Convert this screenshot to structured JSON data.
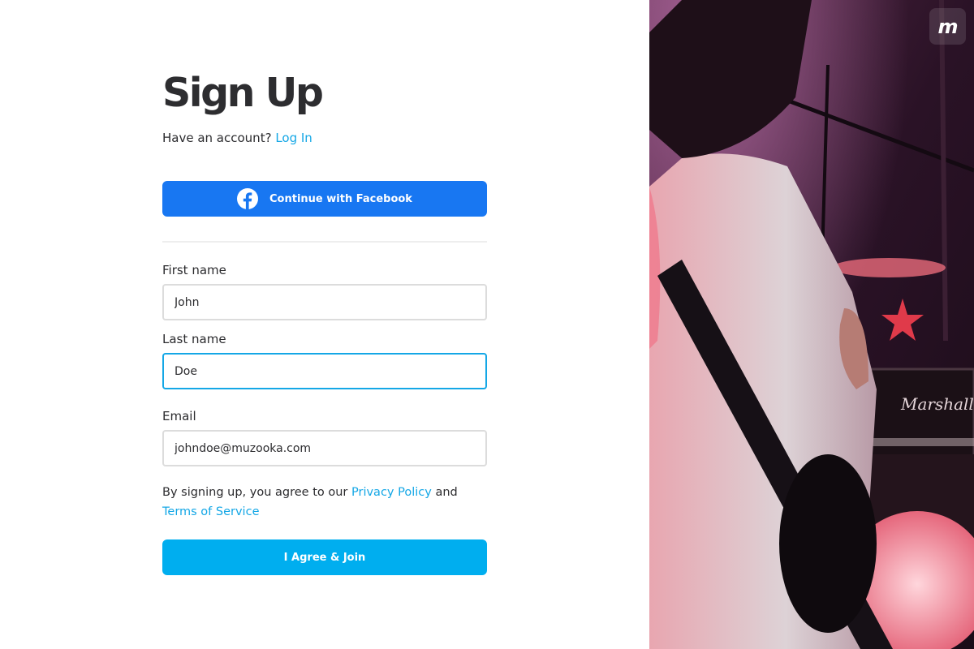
{
  "page": {
    "title": "Sign Up",
    "have_account_text": "Have an account?",
    "login_link": "Log In"
  },
  "facebook": {
    "label": "Continue with Facebook",
    "icon": "facebook-icon",
    "color": "#1877f2"
  },
  "form": {
    "first_name": {
      "label": "First name",
      "value": "John"
    },
    "last_name": {
      "label": "Last name",
      "value": "Doe"
    },
    "email": {
      "label": "Email",
      "value": "johndoe@muzooka.com"
    }
  },
  "terms": {
    "prefix": "By signing up, you agree to our",
    "privacy_link": "Privacy Policy",
    "and": "and",
    "terms_link": "Terms of Service"
  },
  "join_button": {
    "label": "I Agree & Join",
    "color": "#00aeef"
  },
  "brand": {
    "logo": "m",
    "accent": "#14a7e6"
  },
  "hero": {
    "image": "concert-guitarist-photo"
  }
}
